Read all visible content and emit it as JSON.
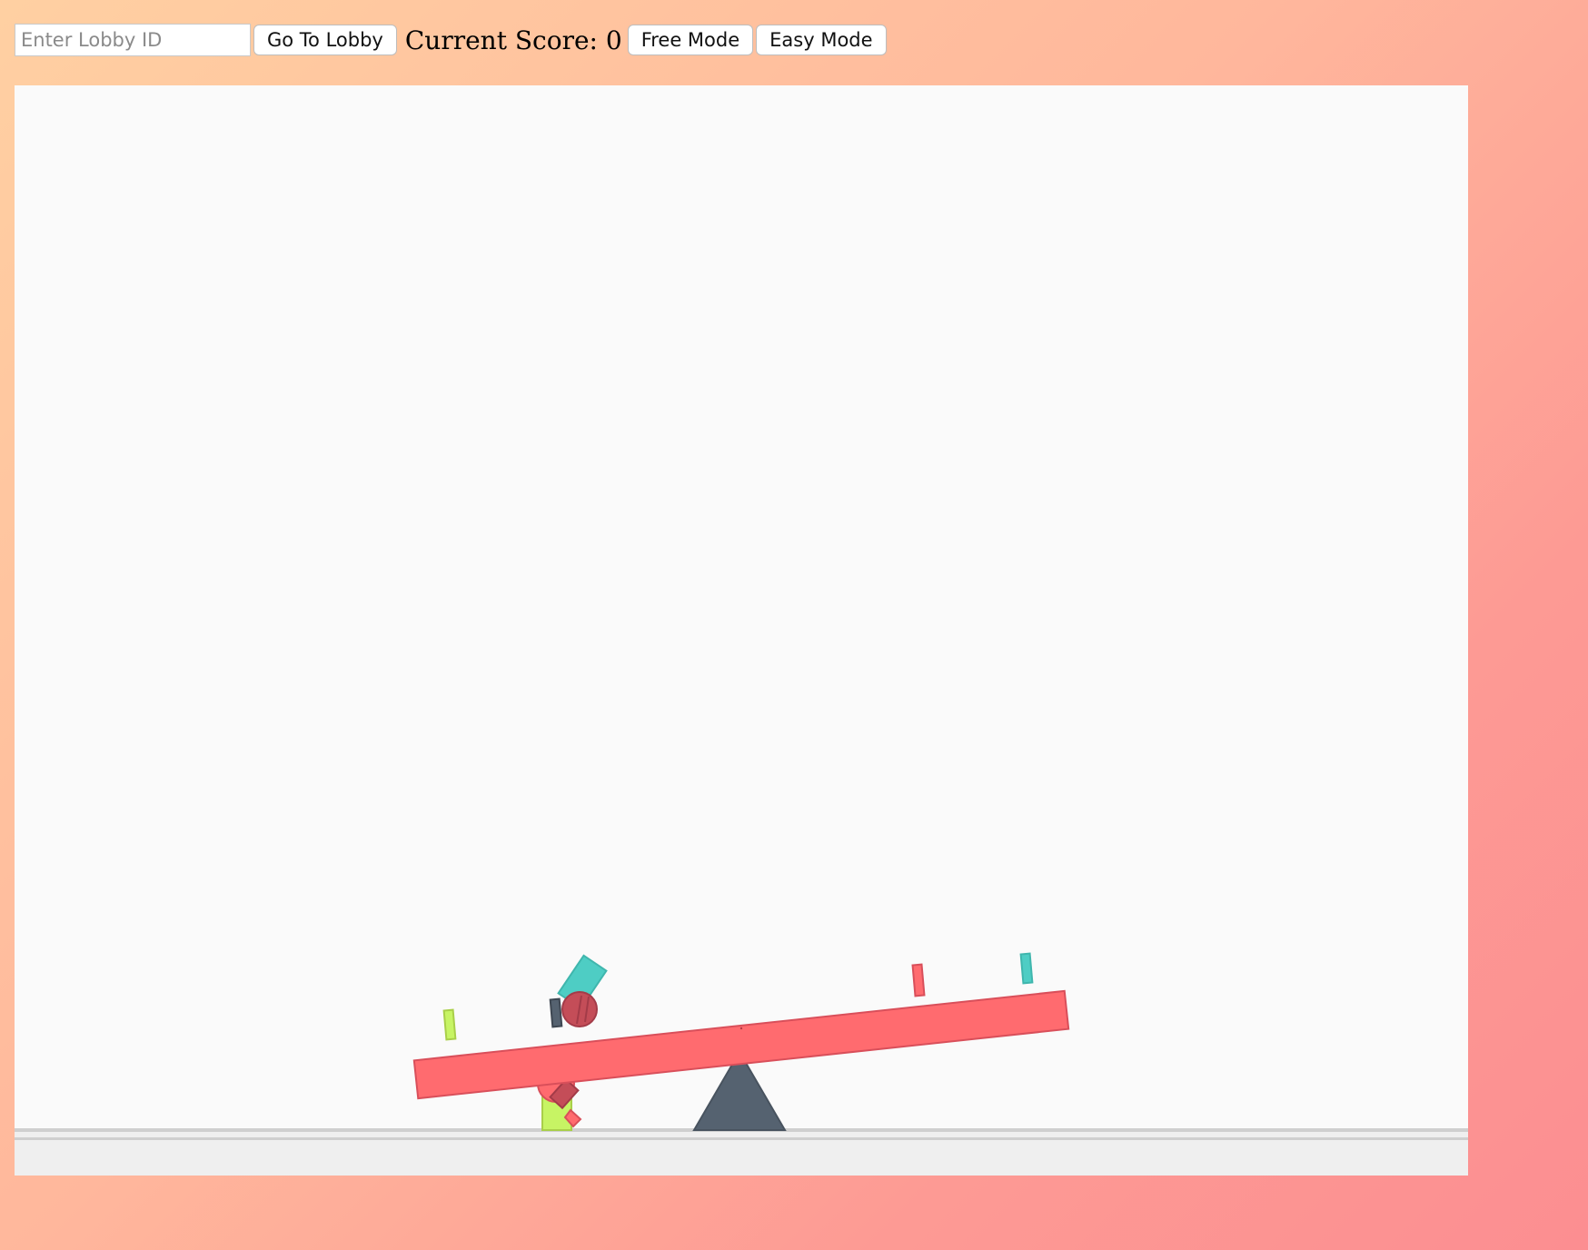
{
  "toolbar": {
    "lobby_placeholder": "Enter Lobby ID",
    "go_to_lobby_label": "Go To Lobby",
    "score_label": "Current Score:",
    "score_value": "0",
    "free_mode_label": "Free Mode",
    "easy_mode_label": "Easy Mode"
  },
  "game": {
    "colors": {
      "background": "#fafafa",
      "ground": "#efefef",
      "ground_line": "#cfcfcf",
      "plank": "#ff6b6f",
      "plank_stroke": "#d94f5a",
      "fulcrum": "#556270",
      "teal": "#4ecdc4",
      "lime": "#c7f464",
      "dark_red": "#c44d58"
    },
    "objects": [
      "plank",
      "fulcrum",
      "teal-block",
      "lime-peg",
      "red-peg",
      "teal-peg",
      "red-ball",
      "lime-block",
      "dark-slab"
    ]
  }
}
